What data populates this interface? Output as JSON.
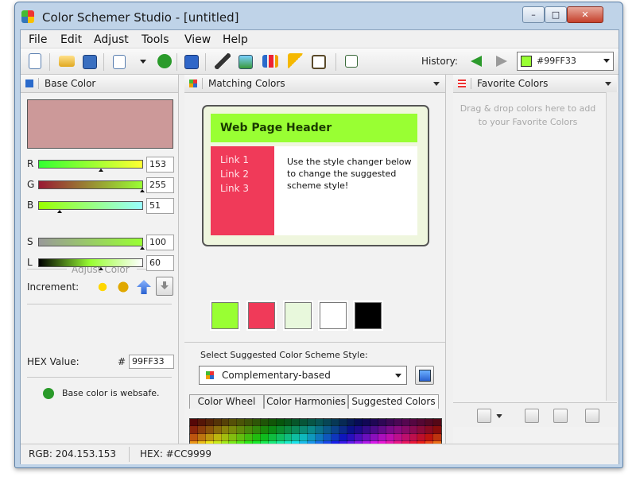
{
  "window": {
    "title": "Color Schemer Studio - [untitled]",
    "min_symbol": "–",
    "max_symbol": "□",
    "close_symbol": "✕"
  },
  "menu": [
    "File",
    "Edit",
    "Adjust",
    "Tools",
    "View",
    "Help"
  ],
  "toolbar": {
    "icons": [
      "new-document-icon",
      "open-folder-icon",
      "save-icon",
      "copy-icon",
      "dropdown-icon",
      "check-icon",
      "help-icon",
      "eyedropper-icon",
      "picture-icon",
      "chart-icon",
      "wand-icon",
      "window-icon",
      "export-icon"
    ],
    "history_label": "History:",
    "history_value": "#99FF33",
    "history_swatch": "#99ff33"
  },
  "base_color": {
    "title": "Base Color",
    "preview": "#cc9999",
    "sliders": [
      {
        "label": "R",
        "value": "153",
        "position": 0.6,
        "gradient": "linear-gradient(to right,#33ff33,#ffff33)"
      },
      {
        "label": "G",
        "value": "255",
        "position": 1.0,
        "gradient": "linear-gradient(to right,#991933,#99ff33)"
      },
      {
        "label": "B",
        "value": "51",
        "position": 0.2,
        "gradient": "linear-gradient(to right,#99ff00,#99ffff)"
      },
      {
        "label": "S",
        "value": "100",
        "position": 1.0,
        "gradient": "linear-gradient(to right,#999999,#99ff33)"
      },
      {
        "label": "L",
        "value": "60",
        "position": 0.6,
        "gradient": "linear-gradient(to right,#000000,#99ff33,#ffffff)"
      }
    ],
    "adjust_title": "Adjust Color",
    "increment_label": "Increment:",
    "hex_label": "HEX Value:",
    "hex_hash": "#",
    "hex_value": "99FF33",
    "websafe_text": "Base color is websafe."
  },
  "matching": {
    "title": "Matching Colors",
    "header_text": "Web Page Header",
    "links": [
      "Link 1",
      "Link 2",
      "Link 3"
    ],
    "body_text": "Use the style changer below to change the suggested scheme style!",
    "swatches": [
      "#99ff33",
      "#f03a59",
      "#e8f8dc",
      "#ffffff",
      "#000000"
    ],
    "style_label": "Select Suggested Color Scheme Style:",
    "style_value": "Complementary-based",
    "tabs": [
      "Color Wheel",
      "Color Harmonies",
      "Suggested Colors"
    ]
  },
  "favorites": {
    "title": "Favorite Colors",
    "hint": "Drag & drop colors here to add to your Favorite Colors"
  },
  "status": {
    "rgb": "RGB: 204.153.153",
    "hex": "HEX: #CC9999"
  }
}
